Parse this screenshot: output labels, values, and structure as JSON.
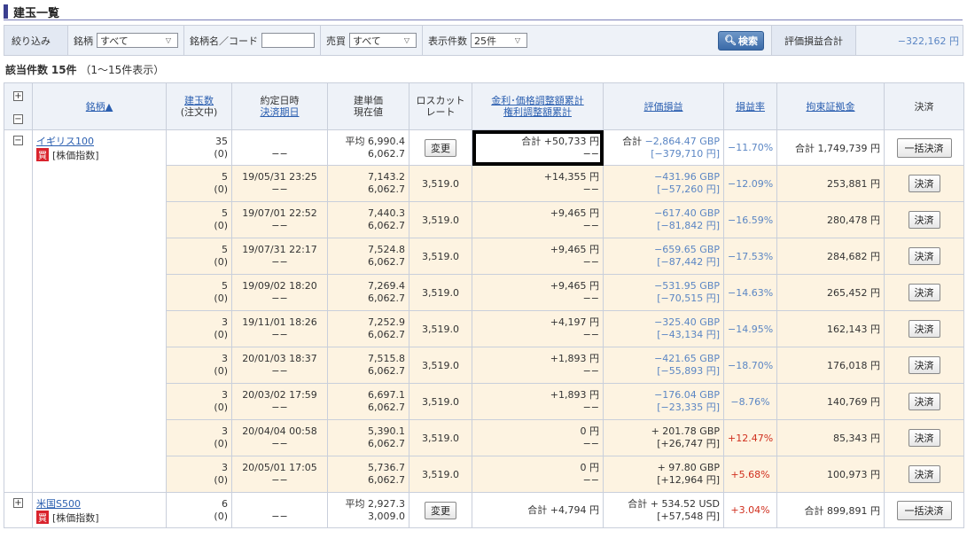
{
  "page_title": "建玉一覧",
  "filter": {
    "label": "絞り込み",
    "brand_label": "銘柄",
    "brand_value": "すべて",
    "name_code_label": "銘柄名／コード",
    "trade_label": "売買",
    "trade_value": "すべて",
    "display_label": "表示件数",
    "display_value": "25件",
    "search_label": "検索",
    "eval_total_label": "評価損益合計",
    "eval_total_value": "−322,162 円"
  },
  "count": {
    "label": "該当件数",
    "value": "15件",
    "range": "（1〜15件表示）"
  },
  "headers": {
    "brand": "銘柄▲",
    "qty1": "建玉数",
    "qty2": "(注文中)",
    "date1": "約定日時",
    "date2": "決済期日",
    "price1": "建単価",
    "price2": "現在値",
    "losscut1": "ロスカット",
    "losscut2": "レート",
    "fund1": "金利･価格調整額累計",
    "fund2": "権利調整額累計",
    "eval": "評価損益",
    "rate": "損益率",
    "margin": "拘束証拠金",
    "settle": "決済"
  },
  "groups": [
    {
      "name": "イギリス100",
      "side": "買",
      "type": "[株価指数]",
      "expand": "−",
      "qty": "35",
      "qty_pending": "(0)",
      "date": "",
      "settle_date": "−−",
      "price": "平均 6,990.4",
      "current": "6,062.7",
      "change_btn": "変更",
      "fund": "合計 +50,733 円",
      "rights": "−−",
      "eval_prefix": "合計",
      "eval_gbp": "−2,864.47 GBP",
      "eval_jpy": "[−379,710 円]",
      "rate": "−11.70%",
      "margin": "合計 1,749,739 円",
      "settle_btn": "一括決済",
      "rows": [
        {
          "qty": "5",
          "pend": "(0)",
          "date": "19/05/31 23:25",
          "sd": "−−",
          "price": "7,143.2",
          "cur": "6,062.7",
          "lc": "3,519.0",
          "fund": "+14,355 円",
          "rights": "−−",
          "gbp": "−431.96 GBP",
          "jpy": "[−57,260 円]",
          "rate": "−12.09%",
          "margin": "253,881 円",
          "btn": "決済",
          "sign": "neg"
        },
        {
          "qty": "5",
          "pend": "(0)",
          "date": "19/07/01 22:52",
          "sd": "−−",
          "price": "7,440.3",
          "cur": "6,062.7",
          "lc": "3,519.0",
          "fund": "+9,465 円",
          "rights": "−−",
          "gbp": "−617.40 GBP",
          "jpy": "[−81,842 円]",
          "rate": "−16.59%",
          "margin": "280,478 円",
          "btn": "決済",
          "sign": "neg"
        },
        {
          "qty": "5",
          "pend": "(0)",
          "date": "19/07/31 22:17",
          "sd": "−−",
          "price": "7,524.8",
          "cur": "6,062.7",
          "lc": "3,519.0",
          "fund": "+9,465 円",
          "rights": "−−",
          "gbp": "−659.65 GBP",
          "jpy": "[−87,442 円]",
          "rate": "−17.53%",
          "margin": "284,682 円",
          "btn": "決済",
          "sign": "neg"
        },
        {
          "qty": "5",
          "pend": "(0)",
          "date": "19/09/02 18:20",
          "sd": "−−",
          "price": "7,269.4",
          "cur": "6,062.7",
          "lc": "3,519.0",
          "fund": "+9,465 円",
          "rights": "−−",
          "gbp": "−531.95 GBP",
          "jpy": "[−70,515 円]",
          "rate": "−14.63%",
          "margin": "265,452 円",
          "btn": "決済",
          "sign": "neg"
        },
        {
          "qty": "3",
          "pend": "(0)",
          "date": "19/11/01 18:26",
          "sd": "−−",
          "price": "7,252.9",
          "cur": "6,062.7",
          "lc": "3,519.0",
          "fund": "+4,197 円",
          "rights": "−−",
          "gbp": "−325.40 GBP",
          "jpy": "[−43,134 円]",
          "rate": "−14.95%",
          "margin": "162,143 円",
          "btn": "決済",
          "sign": "neg"
        },
        {
          "qty": "3",
          "pend": "(0)",
          "date": "20/01/03 18:37",
          "sd": "−−",
          "price": "7,515.8",
          "cur": "6,062.7",
          "lc": "3,519.0",
          "fund": "+1,893 円",
          "rights": "−−",
          "gbp": "−421.65 GBP",
          "jpy": "[−55,893 円]",
          "rate": "−18.70%",
          "margin": "176,018 円",
          "btn": "決済",
          "sign": "neg"
        },
        {
          "qty": "3",
          "pend": "(0)",
          "date": "20/03/02 17:59",
          "sd": "−−",
          "price": "6,697.1",
          "cur": "6,062.7",
          "lc": "3,519.0",
          "fund": "+1,893 円",
          "rights": "−−",
          "gbp": "−176.04 GBP",
          "jpy": "[−23,335 円]",
          "rate": "−8.76%",
          "margin": "140,769 円",
          "btn": "決済",
          "sign": "neg"
        },
        {
          "qty": "3",
          "pend": "(0)",
          "date": "20/04/04 00:58",
          "sd": "−−",
          "price": "5,390.1",
          "cur": "6,062.7",
          "lc": "3,519.0",
          "fund": "0 円",
          "rights": "−−",
          "gbp": "+ 201.78 GBP",
          "jpy": "[+26,747 円]",
          "rate": "+12.47%",
          "margin": "85,343 円",
          "btn": "決済",
          "sign": "pos"
        },
        {
          "qty": "3",
          "pend": "(0)",
          "date": "20/05/01 17:05",
          "sd": "−−",
          "price": "5,736.7",
          "cur": "6,062.7",
          "lc": "3,519.0",
          "fund": "0 円",
          "rights": "−−",
          "gbp": "+ 97.80 GBP",
          "jpy": "[+12,964 円]",
          "rate": "+5.68%",
          "margin": "100,973 円",
          "btn": "決済",
          "sign": "pos"
        }
      ]
    },
    {
      "name": "米国S500",
      "side": "買",
      "type": "[株価指数]",
      "expand": "+",
      "qty": "6",
      "qty_pending": "(0)",
      "date": "",
      "settle_date": "−−",
      "price": "平均 2,927.3",
      "current": "3,009.0",
      "change_btn": "変更",
      "fund": "合計 +4,794 円",
      "rights": "",
      "eval_prefix": "合計",
      "eval_gbp": "+ 534.52 USD",
      "eval_jpy": "[+57,548 円]",
      "rate": "+3.04%",
      "margin": "合計 899,891 円",
      "settle_btn": "一括決済"
    }
  ],
  "colors": {
    "accent": "#3b3f8f",
    "header_bg": "#eef2f8",
    "row_bg": "#fdf3e1",
    "negative": "#5b86c4",
    "positive": "#d0301f"
  }
}
